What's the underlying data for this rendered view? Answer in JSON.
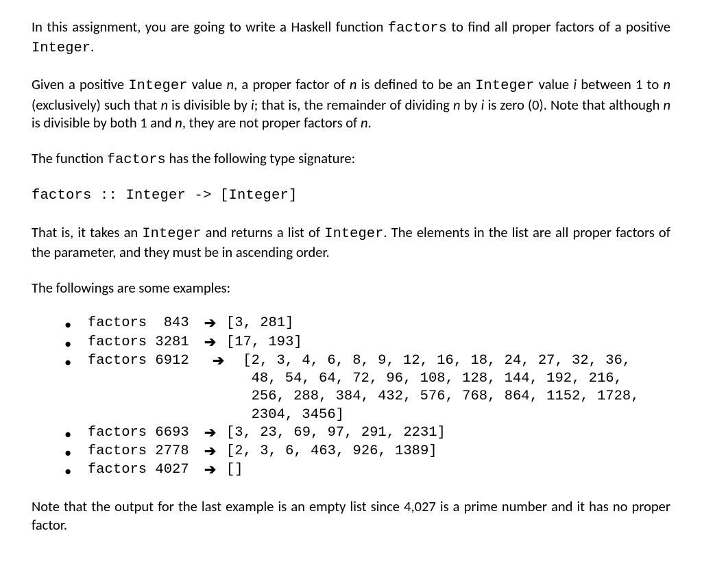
{
  "para1": {
    "t1": "In this assignment, you are going to write a Haskell function ",
    "code1": "factors",
    "t2": " to find all proper factors of a positive ",
    "code2": "Integer",
    "t3": "."
  },
  "para2": {
    "t1": "Given a positive ",
    "code1": "Integer",
    "t2": " value ",
    "it1": "n",
    "t3": ", a proper factor of ",
    "it2": "n",
    "t4": " is defined to be an ",
    "code2": "Integer",
    "t5": " value ",
    "it3": "i",
    "t6": " between 1 to ",
    "it4": "n",
    "t7": " (exclusively) such that ",
    "it5": "n",
    "t8": " is divisible by ",
    "it6": "i",
    "t9": "; that is, the remainder of dividing ",
    "it7": "n",
    "t10": " by ",
    "it8": "i",
    "t11": " is zero (0). Note that although ",
    "it9": "n",
    "t12": " is divisible by both 1 and ",
    "it10": "n",
    "t13": ", they are not proper factors of ",
    "it11": "n",
    "t14": "."
  },
  "para3": {
    "t1": "The function ",
    "code1": "factors",
    "t2": " has the following type signature:"
  },
  "signature": "factors :: Integer -> [Integer]",
  "para4": {
    "t1": "That is, it takes an ",
    "code1": "Integer",
    "t2": " and returns a list of ",
    "code2": "Integer",
    "t3": ". The elements in the list are all proper factors of the parameter, and they must be in ascending order."
  },
  "para5": "The followings are some examples:",
  "examples": [
    {
      "call": "factors  843",
      "arrow": "➔",
      "result": "[3, 281]"
    },
    {
      "call": "factors 3281",
      "arrow": "➔",
      "result": "[17, 193]"
    },
    {
      "call": "factors 6912",
      "arrow": "➔",
      "result_lines": [
        " [2, 3, 4, 6, 8, 9, 12, 16, 18, 24, 27, 32, 36,",
        "  48, 54, 64, 72, 96, 108, 128, 144, 192, 216,",
        "  256, 288, 384, 432, 576, 768, 864, 1152, 1728,",
        "  2304, 3456]"
      ]
    },
    {
      "call": "factors 6693",
      "arrow": "➔",
      "result": "[3, 23, 69, 97, 291, 2231]"
    },
    {
      "call": "factors 2778",
      "arrow": "➔",
      "result": "[2, 3, 6, 463, 926, 1389]"
    },
    {
      "call": "factors 4027",
      "arrow": "➔",
      "result": "[]"
    }
  ],
  "para6": "Note that the output for the last example is an empty list since 4,027 is a prime number and it has no proper factor."
}
